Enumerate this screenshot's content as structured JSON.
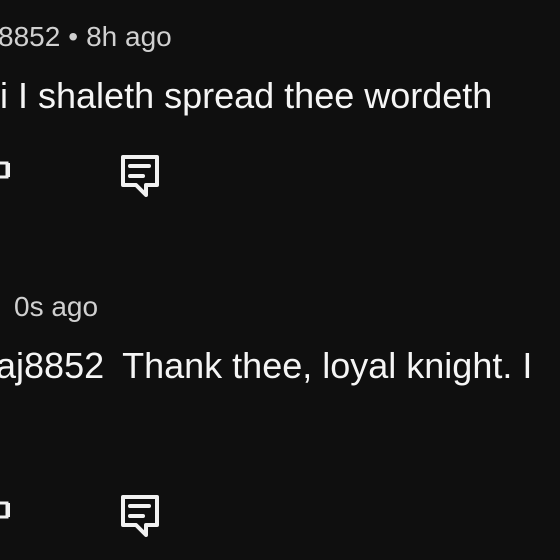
{
  "comments": [
    {
      "meta_prefix": "8852",
      "meta_sep": "•",
      "meta_time": "8h ago",
      "text": "i I shaleth spread thee wordeth",
      "icons": {
        "like": "thumb-icon",
        "reply": "comment-reply-icon"
      }
    },
    {
      "meta_prefix": "",
      "meta_sep": "",
      "meta_time": "0s ago",
      "mention": "aj8852",
      "text": "Thank thee, loyal knight. I",
      "icons": {
        "like": "thumb-icon",
        "reply": "comment-reply-icon"
      }
    }
  ],
  "theme": {
    "background": "#0f0f0f",
    "text": "#f1f1f1",
    "muted": "#d0d0d0"
  }
}
